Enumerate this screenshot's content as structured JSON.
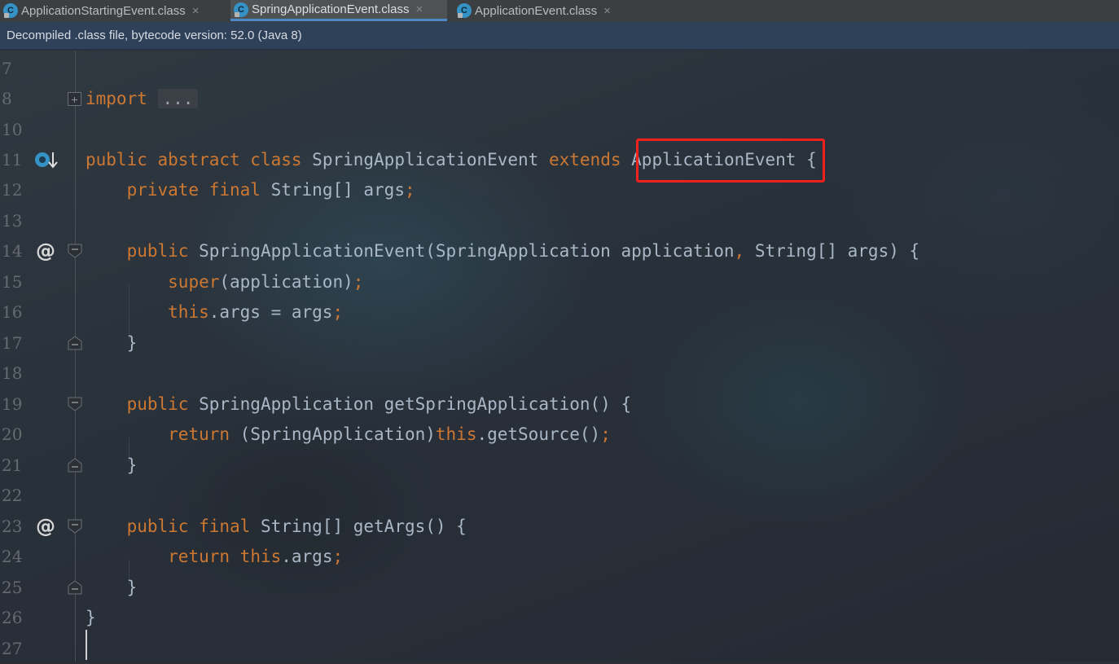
{
  "tabs": [
    {
      "label": "ApplicationStartingEvent.class",
      "close": "×",
      "icon": "class-icon"
    },
    {
      "label": "SpringApplicationEvent.class",
      "close": "×",
      "icon": "class-icon"
    },
    {
      "label": "ApplicationEvent.class",
      "close": "×",
      "icon": "class-icon"
    }
  ],
  "active_tab": "SpringApplicationEvent.class",
  "infobar": {
    "text": "Decompiled .class file, bytecode version: 52.0 (Java 8)"
  },
  "editor": {
    "line_numbers": [
      "7",
      "8",
      "10",
      "11",
      "12",
      "13",
      "14",
      "15",
      "16",
      "17",
      "18",
      "19",
      "20",
      "21",
      "22",
      "23",
      "24",
      "25",
      "26",
      "27"
    ],
    "lines": {
      "l8_import": "import",
      "l8_dots": "...",
      "l11_kw": "public abstract class",
      "l11_name": "SpringApplicationEvent",
      "l11_extends": "extends",
      "l11_super": "ApplicationEvent",
      "l11_brace": "{",
      "l12_kw": "private final",
      "l12_rest": "String[] args",
      "l12_semi": ";",
      "l14_kw": "public",
      "l14_sig": "SpringApplicationEvent(SpringApplication application",
      "l14_comma": ",",
      "l14_rest": "String[] args) {",
      "l15_kw": "super",
      "l15_rest": "(application)",
      "l15_semi": ";",
      "l16_kw": "this",
      "l16_rest": ".args = args",
      "l16_semi": ";",
      "l17": "}",
      "l19_kw": "public",
      "l19_rest": "SpringApplication getSpringApplication() {",
      "l20_kw": "return",
      "l20_cast": "(SpringApplication)",
      "l20_this": "this",
      "l20_rest": ".getSource()",
      "l20_semi": ";",
      "l21": "}",
      "l23_kw": "public final",
      "l23_rest": "String[] getArgs() {",
      "l24_kw": "return",
      "l24_this": "this",
      "l24_rest": ".args",
      "l24_semi": ";",
      "l25": "}",
      "l26": "}"
    },
    "gutter_icons": {
      "override_marker": "@",
      "implemented_icon": "override-down-icon"
    }
  },
  "highlight": {
    "text": "ApplicationEvent",
    "color": "#f0201c"
  },
  "colors": {
    "keyword": "#cc7832",
    "plain": "#a9b7c6",
    "line_number": "#666b70",
    "tab_active_underline": "#4a88c7",
    "infobar_bg": "#2f4159"
  }
}
